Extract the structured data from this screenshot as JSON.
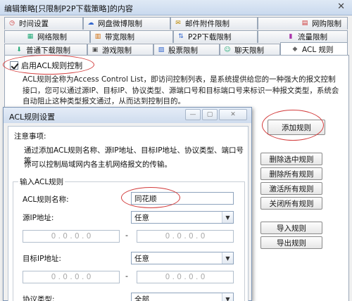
{
  "window": {
    "title": "编辑策略[只限制P2P下载策略]的内容",
    "close_glyph": "✕"
  },
  "tabs_row1": [
    {
      "label": "时间设置",
      "icon": "clock-icon",
      "glyph": "◷"
    },
    {
      "label": "网盘微博限制",
      "icon": "cloud-icon",
      "glyph": "☁"
    },
    {
      "label": "邮件附件限制",
      "icon": "mail-icon",
      "glyph": "✉"
    },
    {
      "label": "网购限制",
      "icon": "cart-icon",
      "glyph": "▤"
    }
  ],
  "tabs_row2": [
    {
      "label": "网络限制",
      "icon": "network-icon",
      "glyph": "▦"
    },
    {
      "label": "带宽限制",
      "icon": "bandwidth-icon",
      "glyph": "▥"
    },
    {
      "label": "P2P下载限制",
      "icon": "p2p-icon",
      "glyph": "⇅"
    },
    {
      "label": "流量限制",
      "icon": "traffic-icon",
      "glyph": "▮"
    }
  ],
  "tabs_row3": [
    {
      "label": "普通下载限制",
      "icon": "download-icon",
      "glyph": "⬇"
    },
    {
      "label": "游戏限制",
      "icon": "game-icon",
      "glyph": "▣"
    },
    {
      "label": "股票限制",
      "icon": "stock-icon",
      "glyph": "▨"
    },
    {
      "label": "聊天限制",
      "icon": "chat-icon",
      "glyph": "☺"
    },
    {
      "label": "ACL 规则",
      "icon": "acl-icon",
      "glyph": "◆"
    }
  ],
  "acl": {
    "enable_label": "启用ACL规则控制",
    "enabled": true,
    "description": "ACL规则全称为Access Control List，即访问控制列表，是系统提供给您的一种强大的报文控制接口，您可以通过源IP、目标IP、协议类型、源端口号和目标端口号来标识一种报文类型，系统会自动阻止这种类型报文通过，从而达到控制目的。"
  },
  "side_buttons": {
    "add": "添加规则",
    "delete_selected": "删除选中规则",
    "delete_all": "删除所有规则",
    "activate_all": "激活所有规则",
    "close_all": "关闭所有规则",
    "import": "导入规则",
    "export": "导出规则"
  },
  "dialog": {
    "title": "ACL规则设置",
    "notes_heading": "注意事项:",
    "note_line1": "通过添加ACL规则名称、源IP地址、目标IP地址、协议类型、端口号等",
    "note_line2": "你可以控制局域网内各主机网络报文的传输。",
    "input_group": "输入ACL规则",
    "name_label": "ACL规则名称:",
    "name_value": "同花顺",
    "src_ip_label": "源IP地址:",
    "src_ip_option": "任意",
    "dst_ip_label": "目标IP地址:",
    "dst_ip_option": "任意",
    "protocol_label": "协议类型:",
    "protocol_option": "全部",
    "ip_placeholder": "0   .   0   .   0   .   0",
    "dash": "-"
  }
}
